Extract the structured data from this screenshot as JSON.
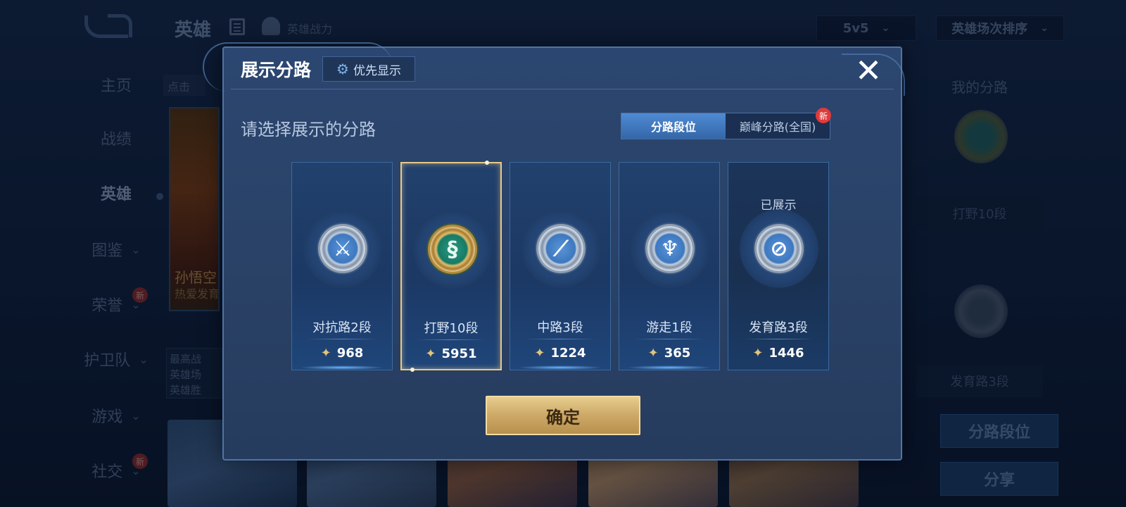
{
  "colors": {
    "dialog_bg": "#2a4267",
    "selected_border": "#e8c98a",
    "confirm_gold": "#cda866",
    "toggle_active": "#3f79c1",
    "new_badge": "#e03a3a"
  },
  "background": {
    "page_title": "英雄",
    "power_label": "英雄战力",
    "mode_select": "5v5",
    "sort_select": "英雄场次排序",
    "hint_strip": "点击",
    "sidebar": {
      "items": [
        {
          "label": "主页"
        },
        {
          "label": "战绩"
        },
        {
          "label": "英雄"
        },
        {
          "label": "图鉴"
        },
        {
          "label": "荣誉",
          "badge": "新"
        },
        {
          "label": "护卫队"
        },
        {
          "label": "游戏"
        },
        {
          "label": "社交",
          "badge": "新"
        }
      ]
    },
    "hero": {
      "name": "孙悟空",
      "sub": "热爱发育"
    },
    "info_lines": [
      "最高战",
      "英雄场",
      "英雄胜"
    ],
    "right_panel": {
      "title": "我的分路",
      "label1": "打野10段",
      "label2": "发育路3段",
      "btn_lane": "分路段位",
      "btn_share": "分享"
    }
  },
  "dialog": {
    "title": "展示分路",
    "priority_label": "优先显示",
    "subtitle": "请选择展示的分路",
    "toggle": {
      "option1": "分路段位",
      "option2": "巅峰分路(全国)",
      "new_badge": "新",
      "active": "分路段位"
    },
    "lanes": [
      {
        "name": "对抗路2段",
        "score": "968",
        "icon": "sword-shield-icon",
        "selected": false,
        "status": ""
      },
      {
        "name": "打野10段",
        "score": "5951",
        "icon": "dragon-icon",
        "selected": true,
        "status": ""
      },
      {
        "name": "中路3段",
        "score": "1224",
        "icon": "staff-icon",
        "selected": false,
        "status": ""
      },
      {
        "name": "游走1段",
        "score": "365",
        "icon": "wings-icon",
        "selected": false,
        "status": ""
      },
      {
        "name": "发育路3段",
        "score": "1446",
        "icon": "bow-icon",
        "selected": false,
        "status": "已展示"
      }
    ],
    "confirm_label": "确定"
  }
}
